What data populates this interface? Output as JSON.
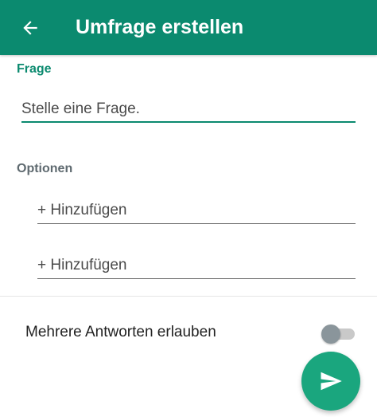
{
  "appbar": {
    "title": "Umfrage erstellen",
    "back_icon": "arrow-left-icon",
    "background_color": "#0b8a6f"
  },
  "question": {
    "label": "Frage",
    "placeholder": "Stelle eine Frage.",
    "value": ""
  },
  "options": {
    "label": "Optionen",
    "items": [
      {
        "placeholder": "+ Hinzufügen",
        "value": ""
      },
      {
        "placeholder": "+ Hinzufügen",
        "value": ""
      }
    ]
  },
  "multiple_answers": {
    "label": "Mehrere Antworten erlauben",
    "enabled": false
  },
  "send_button": {
    "icon": "send-icon",
    "color": "#1aa67e"
  }
}
